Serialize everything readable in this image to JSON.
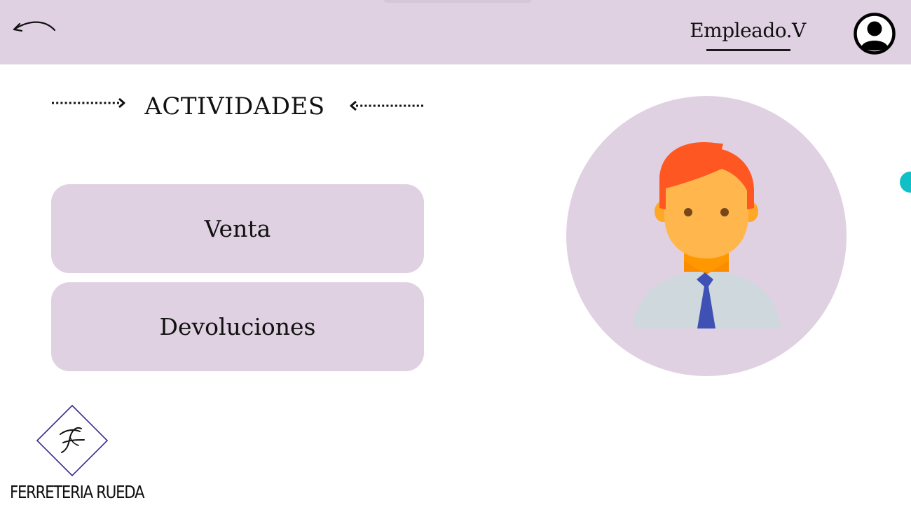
{
  "header": {
    "user_name": "Empleado.V"
  },
  "section": {
    "title": "ACTIVIDADES"
  },
  "actions": [
    {
      "label": "Venta"
    },
    {
      "label": "Devoluciones"
    }
  ],
  "branding": {
    "logo_text": "FERRETERIA RUEDA"
  },
  "icons": {
    "back": "back-arrow-icon",
    "profile": "user-circle-icon",
    "avatar": "employee-avatar-icon",
    "logo": "diamond-f-logo-icon"
  },
  "colors": {
    "panel": "#e0d1e2",
    "accent_dot": "#10c0c6",
    "hair": "#ff5722",
    "skin": "#ffb74d",
    "shirt": "#cfd8dc",
    "tie": "#3f51b5"
  }
}
